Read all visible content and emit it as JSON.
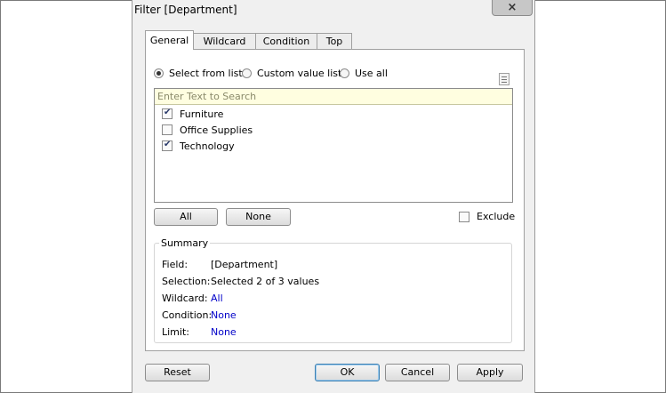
{
  "window": {
    "title": "Filter [Department]",
    "close_icon": "×"
  },
  "tabs": [
    {
      "label": "General",
      "active": true
    },
    {
      "label": "Wildcard",
      "active": false
    },
    {
      "label": "Condition",
      "active": false
    },
    {
      "label": "Top",
      "active": false
    }
  ],
  "general": {
    "modes": [
      {
        "label": "Select from list",
        "checked": true
      },
      {
        "label": "Custom value list",
        "checked": false
      },
      {
        "label": "Use all",
        "checked": false
      }
    ],
    "search_placeholder": "Enter Text to Search",
    "items": [
      {
        "label": "Furniture",
        "checked": true
      },
      {
        "label": "Office Supplies",
        "checked": false
      },
      {
        "label": "Technology",
        "checked": true
      }
    ],
    "all_button": "All",
    "none_button": "None",
    "exclude_label": "Exclude",
    "exclude_checked": false
  },
  "summary": {
    "legend": "Summary",
    "field_label": "Field:",
    "field_value": "[Department]",
    "selection_label": "Selection:",
    "selection_value": "Selected 2 of 3 values",
    "wildcard_label": "Wildcard:",
    "wildcard_value": "All",
    "condition_label": "Condition:",
    "condition_value": "None",
    "limit_label": "Limit:",
    "limit_value": "None"
  },
  "footer": {
    "reset": "Reset",
    "ok": "OK",
    "cancel": "Cancel",
    "apply": "Apply"
  },
  "colors": {
    "link_blue": "#0000c8",
    "search_bg": "#fffee0",
    "dialog_bg": "#f0f0f0"
  }
}
